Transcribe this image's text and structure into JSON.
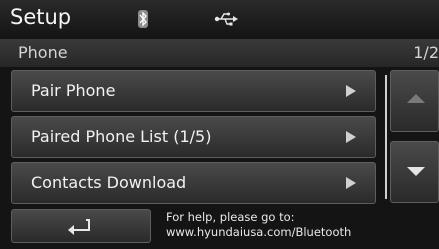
{
  "header": {
    "title": "Setup",
    "status_icons": [
      "bluetooth-icon",
      "usb-icon"
    ]
  },
  "subheader": {
    "section": "Phone",
    "page_indicator": "1/2"
  },
  "menu": {
    "items": [
      {
        "label": "Pair Phone"
      },
      {
        "label": "Paired Phone List (1/5)"
      },
      {
        "label": "Contacts Download"
      }
    ]
  },
  "footer": {
    "back_icon": "return-arrow-icon",
    "help_line1": "For help, please go to:",
    "help_line2": "www.hyundaiusa.com/Bluetooth"
  },
  "colors": {
    "background": "#141414",
    "button": "#3a3a3a",
    "text": "#f2f2f2"
  }
}
